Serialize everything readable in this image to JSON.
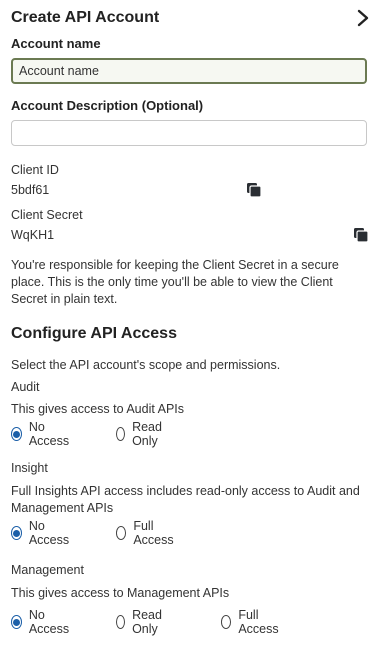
{
  "header": {
    "title": "Create API Account",
    "collapse_icon": "chevron-right-icon"
  },
  "account_name": {
    "label": "Account name",
    "placeholder": "Account name",
    "value": ""
  },
  "account_description": {
    "label": "Account Description (Optional)",
    "placeholder": "",
    "value": ""
  },
  "client_id": {
    "label": "Client ID",
    "value": "5bdf61",
    "copy_icon": "copy-icon"
  },
  "client_secret": {
    "label": "Client Secret",
    "value": "WqKH1",
    "copy_icon": "copy-icon"
  },
  "secret_notice": "You're responsible for keeping the Client Secret in a secure place. This is the only time you'll be able to view the Client Secret in plain text.",
  "configure": {
    "title": "Configure API Access",
    "subtitle": "Select the API account's scope and permissions."
  },
  "audit": {
    "name": "Audit",
    "description": "This gives access to Audit APIs",
    "options": [
      "No Access",
      "Read Only"
    ],
    "selected": "No Access"
  },
  "insight": {
    "name": "Insight",
    "description": "Full Insights API access includes read-only access to Audit and Management APIs",
    "options": [
      "No Access",
      "Full Access"
    ],
    "selected": "No Access"
  },
  "management": {
    "name": "Management",
    "description": "This gives access to Management APIs",
    "options": [
      "No Access",
      "Read Only",
      "Full Access"
    ],
    "selected": "No Access"
  },
  "colors": {
    "accent": "#1b5fa8",
    "focus_border": "#6b7a52",
    "text": "#222222"
  }
}
